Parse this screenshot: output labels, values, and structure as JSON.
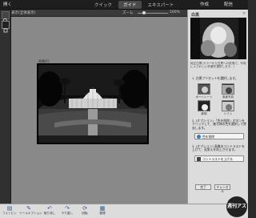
{
  "topbar": {
    "open_label": "開く",
    "tabs": [
      {
        "label": "クイック"
      },
      {
        "label": "ガイド"
      },
      {
        "label": "エキスパート"
      }
    ],
    "create_label": "作成",
    "share_label": "配信"
  },
  "options": {
    "view_label": "表示(全体表示)",
    "zoom_label": "ズーム",
    "zoom_value": "100%",
    "zoom_level_percent": 20
  },
  "canvas": {
    "image_title": "背景(F)"
  },
  "panel": {
    "title": "白黒",
    "close_label": "×",
    "subtitle": "純正白黒(カラーから白黒への変換で、写真にふさわしい外観を選択します。)",
    "step1": "1. 白黒プリセットを選択します。",
    "presets": [
      {
        "label": "ポートレート"
      },
      {
        "label": "風景写真"
      },
      {
        "label": "鮮明"
      },
      {
        "label": "ソフト"
      }
    ],
    "step2": "2. (オプション) 「色を削除」ボタンをクリックして、被写体の色を選択して除去します。",
    "remove_color_button": "色を削除",
    "step3": "3. (オプション) 画像のコントラストを上げて、見栄えを向上させます。",
    "contrast_button": "コントラストを上げる",
    "done_button": "完了",
    "cancel_button": "キャンセル"
  },
  "bottombar": {
    "items": [
      {
        "label": "フォトビン",
        "icon": "photo-bin-icon"
      },
      {
        "label": "ツールオプション",
        "icon": "tool-options-icon"
      },
      {
        "label": "取り消し",
        "icon": "undo-icon"
      },
      {
        "label": "やり直し",
        "icon": "redo-icon"
      },
      {
        "label": "回転",
        "icon": "rotate-icon"
      },
      {
        "label": "整理",
        "icon": "organizer-icon"
      }
    ]
  },
  "watermark": {
    "text": "週刊アスキー"
  }
}
